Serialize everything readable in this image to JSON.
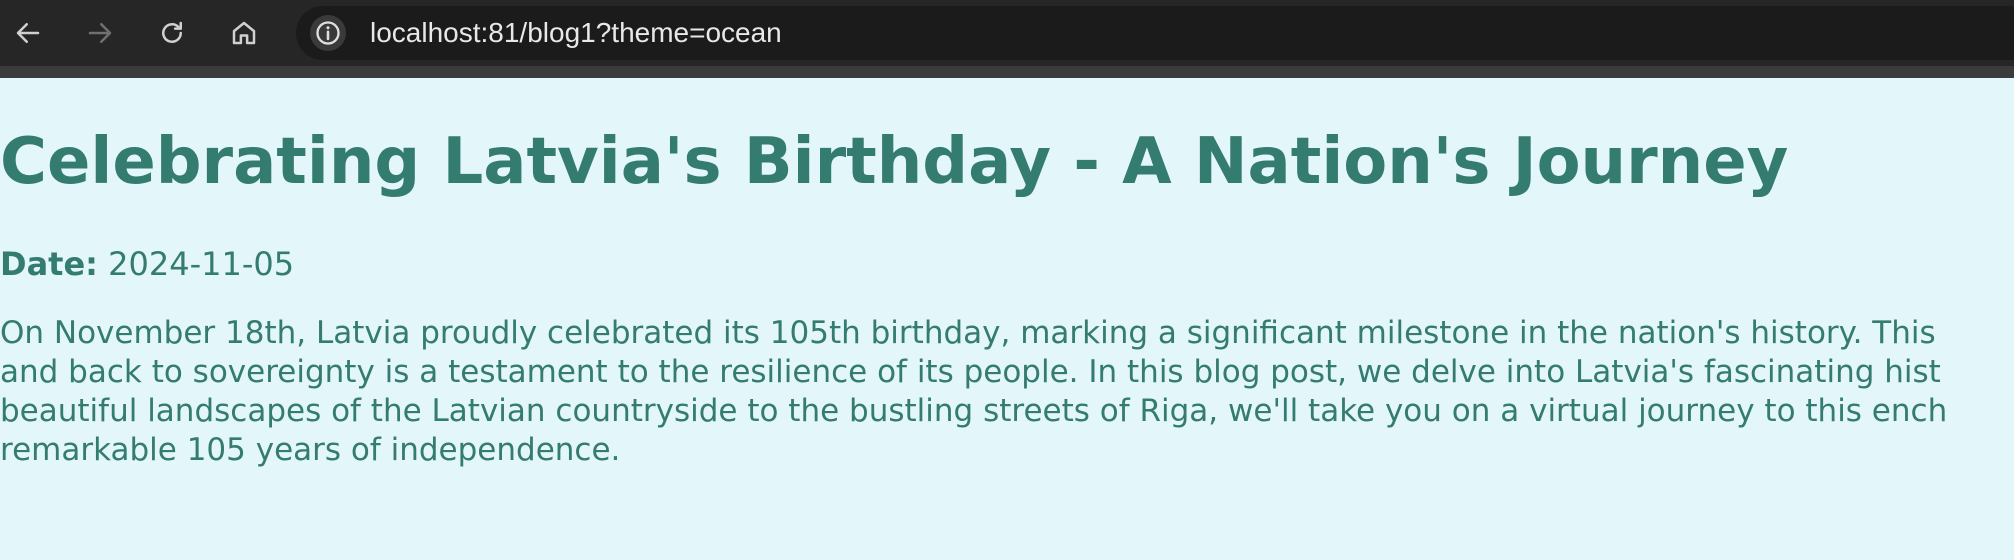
{
  "browser": {
    "url": "localhost:81/blog1?theme=ocean"
  },
  "post": {
    "title": "Celebrating Latvia's Birthday - A Nation's Journey",
    "date_label": "Date:",
    "date_value": "2024-11-05",
    "body_lines": [
      "On November 18th, Latvia proudly celebrated its 105th birthday, marking a significant milestone in the nation's history. This",
      "and back to sovereignty is a testament to the resilience of its people. In this blog post, we delve into Latvia's fascinating hist",
      "beautiful landscapes of the Latvian countryside to the bustling streets of Riga, we'll take you on a virtual journey to this ench",
      "remarkable 105 years of independence."
    ]
  },
  "colors": {
    "page_background": "#e3f6fa",
    "text": "#347b70",
    "toolbar": "#262626"
  }
}
